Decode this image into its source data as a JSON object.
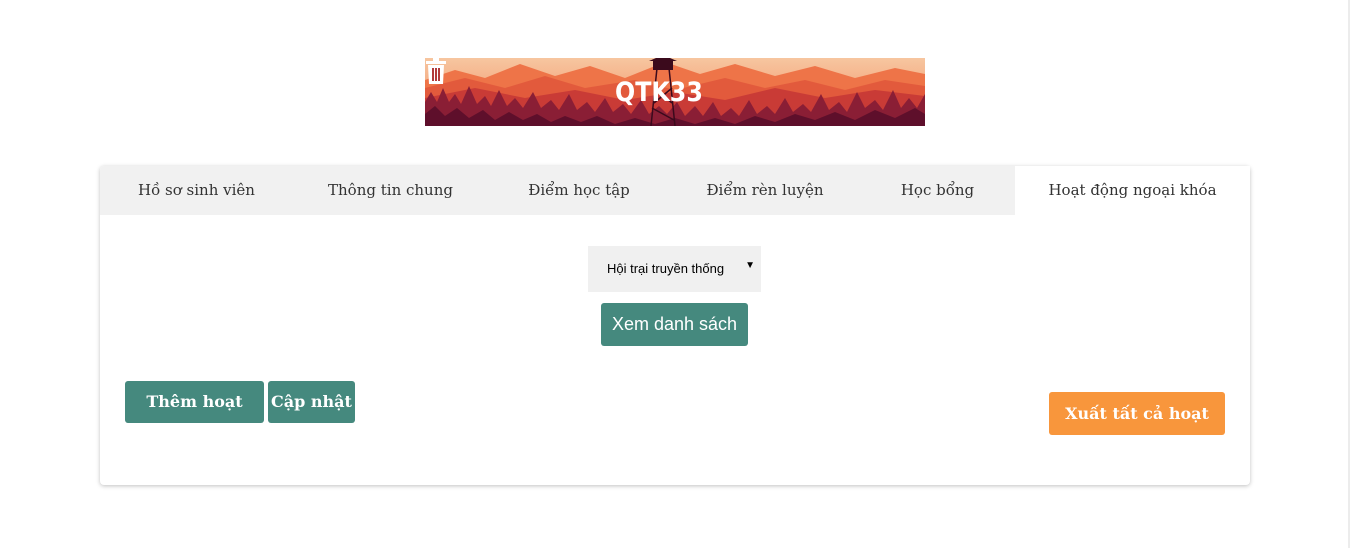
{
  "banner": {
    "title": "QTK33",
    "icon": "trash-icon",
    "colors": {
      "sky": "#f2a277",
      "hills": "#d6463a",
      "forest": "#5e0f2b"
    }
  },
  "tabs": [
    {
      "label": "Hồ sơ sinh viên",
      "active": false
    },
    {
      "label": "Thông tin chung",
      "active": false
    },
    {
      "label": "Điểm học tập",
      "active": false
    },
    {
      "label": "Điểm rèn luyện",
      "active": false
    },
    {
      "label": "Học bổng",
      "active": false
    },
    {
      "label": "Hoạt động ngoại khóa",
      "active": true
    }
  ],
  "activity_select": {
    "selected": "Hội trại truyền thống",
    "icon": "caret-down-icon"
  },
  "buttons": {
    "view_list": "Xem danh sách",
    "add_activity": "Thêm hoạt động",
    "update": "Cập nhật",
    "export_all": "Xuất tất cả hoạt động"
  },
  "colors": {
    "primary": "#45897e",
    "accent": "#f8963c",
    "tab_bar": "#f1f1f1"
  }
}
